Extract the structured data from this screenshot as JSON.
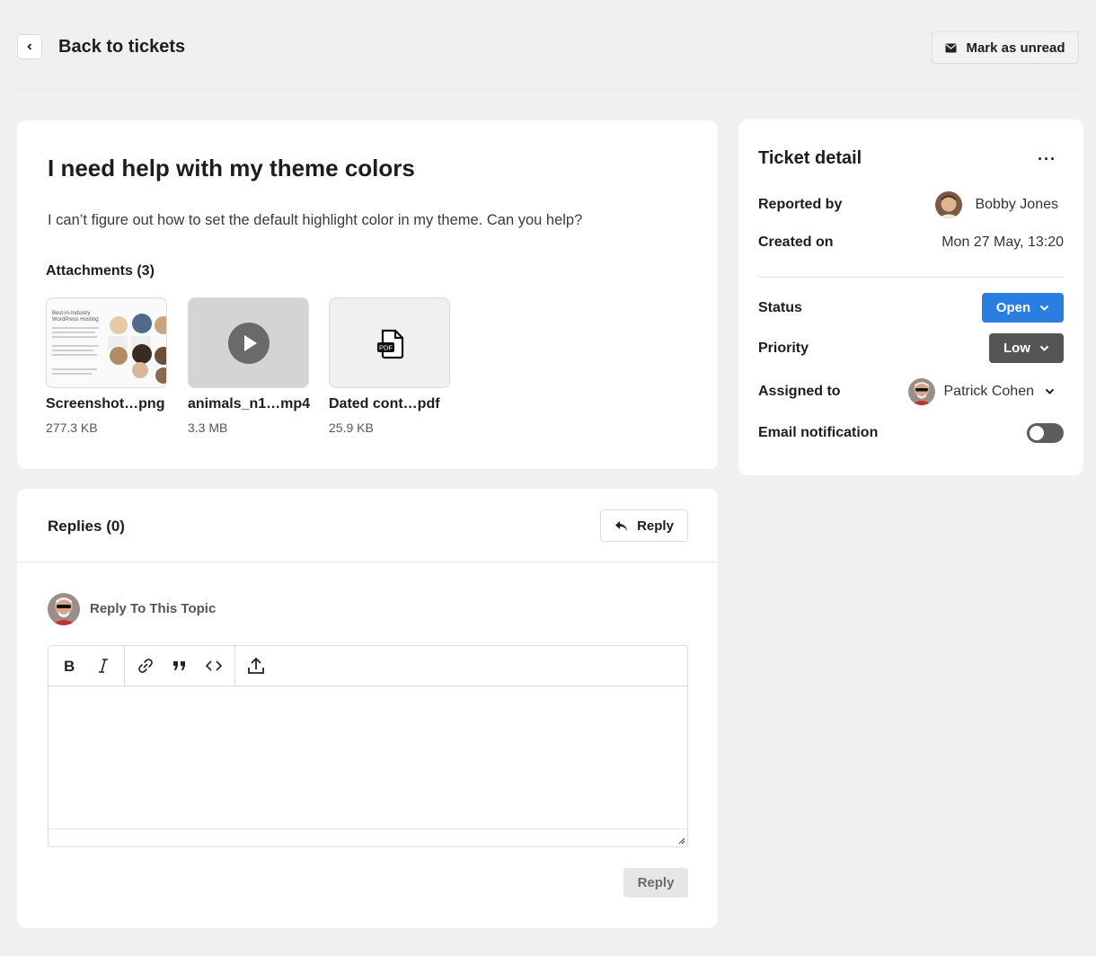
{
  "header": {
    "back_label": "Back to tickets",
    "mark_unread_label": "Mark as unread"
  },
  "ticket": {
    "title": "I need help with my theme colors",
    "body": "I can’t figure out how to set the default highlight color in my theme. Can you help?",
    "attachments_heading": "Attachments (3)",
    "attachments": [
      {
        "name": "Screenshot…png",
        "size": "277.3 KB",
        "kind": "image-thumbnail"
      },
      {
        "name": "animals_n1…mp4",
        "size": "3.3 MB",
        "kind": "video"
      },
      {
        "name": "Dated cont…pdf",
        "size": "25.9 KB",
        "kind": "pdf"
      }
    ],
    "thumbnail_text": {
      "heading": "Best-In-Industry WordPress Hosting"
    }
  },
  "replies": {
    "title": "Replies (0)",
    "reply_button": "Reply",
    "reply_to_label": "Reply To This Topic",
    "submit_label": "Reply",
    "toolbar_icons": [
      "bold-icon",
      "italic-icon",
      "link-icon",
      "quote-icon",
      "code-icon",
      "upload-icon"
    ]
  },
  "detail": {
    "title": "Ticket detail",
    "more": "···",
    "reported_by_label": "Reported by",
    "reported_by": "Bobby Jones",
    "created_on_label": "Created on",
    "created_on": "Mon 27 May, 13:20",
    "status_label": "Status",
    "status": "Open",
    "priority_label": "Priority",
    "priority": "Low",
    "assigned_to_label": "Assigned to",
    "assigned_to": "Patrick Cohen",
    "email_notification_label": "Email notification",
    "email_notification_on": false
  },
  "colors": {
    "status_open": "#2a7de1",
    "priority_low": "#555555",
    "background": "#f0f0f0"
  }
}
